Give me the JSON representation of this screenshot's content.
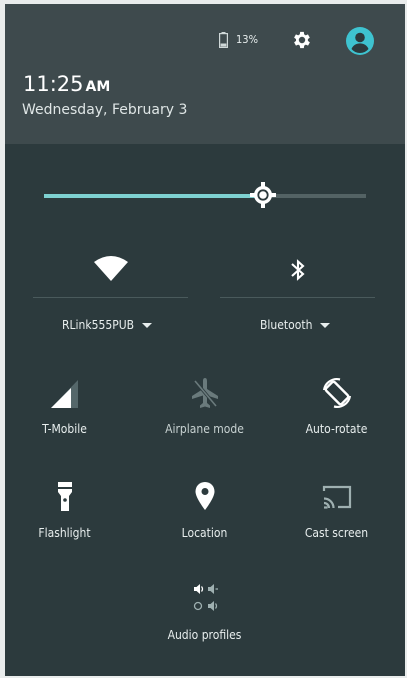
{
  "status": {
    "battery": "13%"
  },
  "clock": {
    "time": "11:25",
    "ampm": "AM",
    "date": "Wednesday, February 3"
  },
  "brightness": {
    "level": 0.68
  },
  "wifi": {
    "network": "RLink555PUB"
  },
  "bluetooth": {
    "label": "Bluetooth"
  },
  "tiles": {
    "cellular": "T-Mobile",
    "airplane": "Airplane mode",
    "rotate": "Auto-rotate",
    "flashlight": "Flashlight",
    "location": "Location",
    "cast": "Cast screen",
    "audio": "Audio profiles"
  },
  "colors": {
    "panel": "#2c3a3d",
    "header": "#3e4a4d",
    "accent": "#7ed1d1",
    "account": "#3ec3d0"
  },
  "icons": [
    "battery-icon",
    "gear-icon",
    "account-icon",
    "wifi-icon",
    "bluetooth-icon",
    "cellular-signal-icon",
    "airplane-icon",
    "auto-rotate-icon",
    "flashlight-icon",
    "location-pin-icon",
    "cast-icon",
    "audio-profiles-icon"
  ]
}
